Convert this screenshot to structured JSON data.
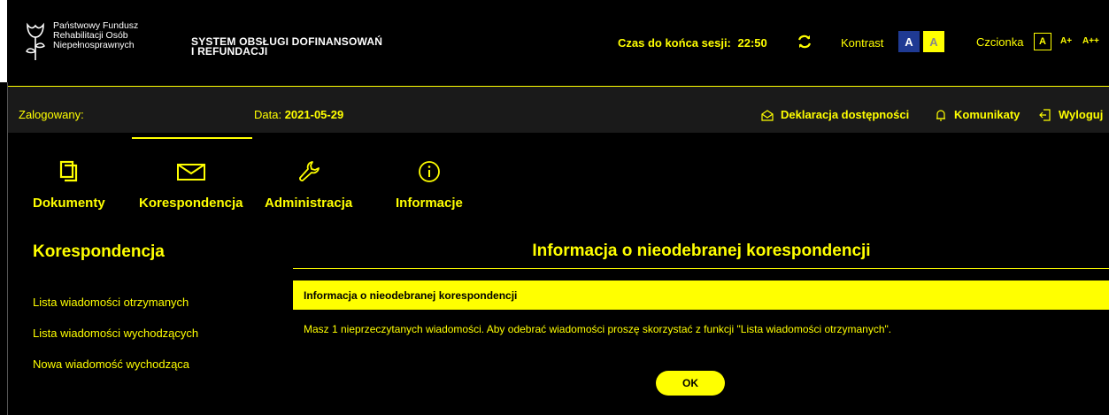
{
  "header": {
    "org_line1": "Państwowy Fundusz",
    "org_line2": "Rehabilitacji Osób",
    "org_line3": "Niepełnosprawnych",
    "system_line1": "SYSTEM OBSŁUGI DOFINANSOWAŃ",
    "system_line2": "I REFUNDACJI",
    "session_label": "Czas do końca sesji:",
    "session_value": "22:50",
    "kontrast_label": "Kontrast",
    "kontrast_a_blue": "A",
    "kontrast_a_yellow": "A",
    "czcionka_label": "Czcionka",
    "font_a": "A",
    "font_a_plus": "A+",
    "font_a_plusplus": "A++"
  },
  "status": {
    "logged_label": "Zalogowany:",
    "date_label": "Data:",
    "date_value": "2021-05-29",
    "declaration": "Deklaracja dostępności",
    "messages": "Komunikaty",
    "logout": "Wyloguj"
  },
  "nav": {
    "items": [
      {
        "label": "Dokumenty",
        "icon": "documents-icon"
      },
      {
        "label": "Korespondencja",
        "icon": "envelope-icon"
      },
      {
        "label": "Administracja",
        "icon": "wrench-icon"
      },
      {
        "label": "Informacje",
        "icon": "info-icon"
      }
    ],
    "active": "Korespondencja"
  },
  "sidebar": {
    "title": "Korespondencja",
    "links": [
      "Lista wiadomości otrzymanych",
      "Lista wiadomości wychodzących",
      "Nowa wiadomość wychodząca"
    ]
  },
  "main": {
    "title": "Informacja o nieodebranej korespondencji",
    "bar_label": "Informacja o nieodebranej korespondencji",
    "message": "Masz 1 nieprzeczytanych wiadomości. Aby odebrać wiadomości proszę skorzystać z funkcji \"Lista wiadomości otrzymanych\".",
    "ok_label": "OK"
  },
  "colors": {
    "accent": "#ffff00",
    "background": "#000000",
    "status_bar": "#1a1a1a",
    "contrast_blue": "#1f3a93"
  }
}
